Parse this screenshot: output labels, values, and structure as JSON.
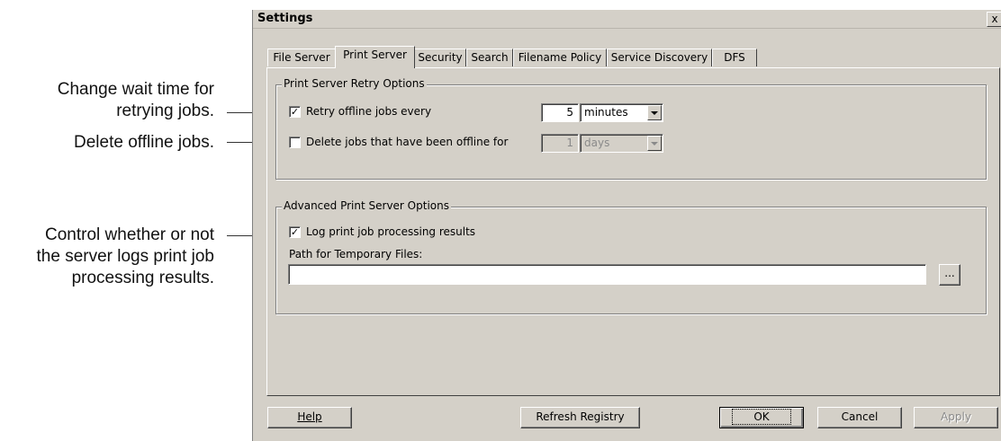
{
  "callouts": [
    {
      "lines": [
        "Change wait time for",
        "retrying jobs."
      ]
    },
    {
      "lines": [
        "Delete offline jobs."
      ]
    },
    {
      "lines": [
        "Control whether or not",
        "the server logs print job",
        "processing results."
      ]
    }
  ],
  "dialog": {
    "title": "Settings",
    "close_label": "x",
    "tabs": [
      "File Server",
      "Print Server",
      "Security",
      "Search",
      "Filename Policy",
      "Service Discovery",
      "DFS"
    ],
    "active_tab": "Print Server",
    "retry_group": {
      "legend": "Print Server Retry Options",
      "retry": {
        "checked": true,
        "label": "Retry offline jobs every",
        "value": "5",
        "unit": "minutes"
      },
      "delete": {
        "checked": false,
        "label": "Delete jobs that have been offline for",
        "value": "1",
        "unit": "days"
      }
    },
    "advanced_group": {
      "legend": "Advanced Print Server Options",
      "log": {
        "checked": true,
        "label": "Log print job processing results"
      },
      "path_label": "Path for Temporary Files:",
      "path_value": "",
      "browse_label": "..."
    },
    "buttons": {
      "help": "Help",
      "refresh": "Refresh Registry",
      "ok": "OK",
      "cancel": "Cancel",
      "apply": "Apply"
    }
  }
}
